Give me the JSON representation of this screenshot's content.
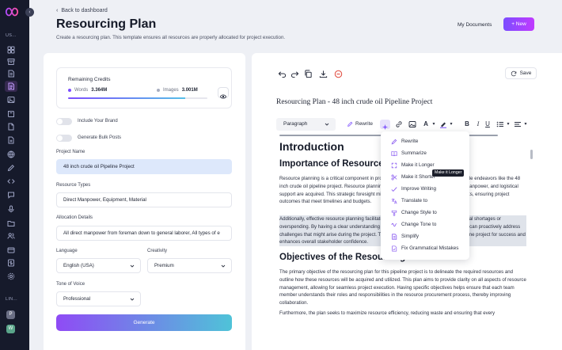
{
  "colors": {
    "sidebar_bg": "#161a2b",
    "accent": "#7b4dff",
    "accent_end": "#c13bff",
    "generate_start": "#8f4bf5",
    "generate_end": "#4fc3d8",
    "words_dot": "#7b4dff",
    "images_dot": "#56c0e8"
  },
  "sidebar": {
    "collapse_icon": "chevron-left-icon",
    "section_user": "US...",
    "section_links": "LIN...",
    "items": [
      {
        "icon": "grid-icon"
      },
      {
        "icon": "archive-icon"
      },
      {
        "icon": "document-icon"
      },
      {
        "icon": "document-text-icon",
        "active": true
      },
      {
        "icon": "image-icon"
      },
      {
        "icon": "book-icon"
      },
      {
        "icon": "file-icon"
      },
      {
        "icon": "file-plus-icon"
      },
      {
        "icon": "globe-icon"
      },
      {
        "icon": "pen-icon"
      },
      {
        "icon": "code-icon"
      },
      {
        "icon": "chat-icon"
      },
      {
        "icon": "microphone-icon"
      },
      {
        "icon": "folder-icon"
      },
      {
        "icon": "users-icon"
      },
      {
        "icon": "card-icon"
      },
      {
        "icon": "dollar-icon"
      },
      {
        "icon": "settings-icon"
      }
    ],
    "apps": [
      {
        "icon": "app-p-icon",
        "label": "P",
        "color": "#6b6f85"
      },
      {
        "icon": "app-w-icon",
        "label": "W",
        "color": "#5aa58a"
      }
    ]
  },
  "header": {
    "back_label": "Back to dashboard",
    "title": "Resourcing Plan",
    "description": "Create a resourcing plan. This template ensures all resources are properly allocated for project execution.",
    "my_documents": "My Documents",
    "new_label": "+ New"
  },
  "credits": {
    "title": "Remaining Credits",
    "words_label": "Words",
    "words_value": "3.364M",
    "images_label": "Images",
    "images_value": "3.001M",
    "words_fraction": 0.84
  },
  "form": {
    "include_brand": "Include Your Brand",
    "bulk_posts": "Generate Bulk Posts",
    "project_name_label": "Project Name",
    "project_name_value": "48 inch crude oil Pipeline Project",
    "resource_types_label": "Resource Types",
    "resource_types_value": "Direct Manpower, Equipment, Material",
    "allocation_label": "Allocation Details",
    "allocation_value": "All direct manpower from foreman down to general laborer, All types of e",
    "language_label": "Language",
    "language_value": "English (USA)",
    "creativity_label": "Creativity",
    "creativity_value": "Premium",
    "tone_label": "Tone of Voice",
    "tone_value": "Professional",
    "generate_label": "Generate"
  },
  "editor": {
    "save_label": "Save",
    "doc_title": "Resourcing Plan - 48 inch crude oil Pipeline Project",
    "paragraph_select": "Paragraph",
    "rewrite_label": "Rewrite",
    "tooltip": "Make it Longer",
    "h1": "Introduction",
    "h2_importance": "Importance of Resource",
    "p1": "Resource planning is a critical component in project management, especially in large-scale endeavors like the 48 inch crude oil pipeline project. Resource planning ensures that all necessary materials, manpower, and logistical support are acquired. This strategic foresight minimizes delays and optimizes project costs, ensuring project outcomes that meet timelines and budgets.",
    "p2": "Additionally, effective resource planning facilitates risk management by identifying potential shortages or overspending. By having a clear understanding of available resources, project managers can proactively address challenges that might arise during the project. This strategic approach positions the pipeline project for success and enhances overall stakeholder confidence.",
    "h2_objectives": "Objectives of the Resourcing Plan",
    "p3": "The primary objective of the resourcing plan for this pipeline project is to delineate the required resources and outline how these resources will be acquired and utilized. This plan aims to provide clarity on all aspects of resource management, allowing for seamless project execution. Having specific objectives helps ensure that each team member understands their roles and responsibilities in the resource procurement process, thereby improving collaboration.",
    "p4": "Furthermore, the plan seeks to maximize resource efficiency, reducing waste and ensuring that every"
  },
  "ai_menu": [
    {
      "label": "Rewrite",
      "icon": "pen-icon"
    },
    {
      "label": "Summarize",
      "icon": "book-open-icon"
    },
    {
      "label": "Make it Longer",
      "icon": "expand-icon"
    },
    {
      "label": "Make it Shorter",
      "icon": "scissors-icon"
    },
    {
      "label": "Improve Writing",
      "icon": "check-icon"
    },
    {
      "label": "Translate to",
      "icon": "translate-icon"
    },
    {
      "label": "Change Style to",
      "icon": "style-icon"
    },
    {
      "label": "Change Tone to",
      "icon": "tone-icon"
    },
    {
      "label": "Simplify",
      "icon": "document-icon"
    },
    {
      "label": "Fix Grammatical Mistakes",
      "icon": "document-check-icon"
    }
  ]
}
